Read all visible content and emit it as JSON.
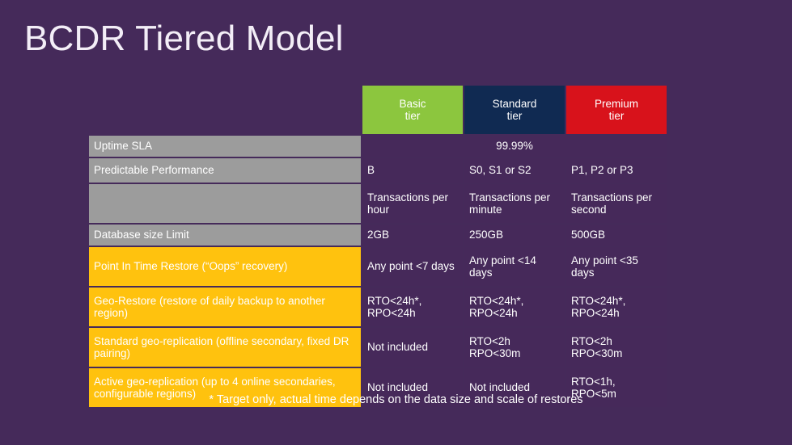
{
  "slide": {
    "title": "BCDR Tiered Model",
    "background_color": "#452A5A",
    "footnote": "* Target only, actual time depends on the data size and scale of restores"
  },
  "table": {
    "columns": [
      {
        "key": "label",
        "label": "",
        "header_color": "transparent"
      },
      {
        "key": "basic",
        "label": "Basic",
        "sub": "tier",
        "header_color": "#8CC63E"
      },
      {
        "key": "standard",
        "label": "Standard",
        "sub": "tier",
        "header_color": "#102A52"
      },
      {
        "key": "premium",
        "label": "Premium",
        "sub": "tier",
        "header_color": "#D8121B"
      }
    ],
    "rows": [
      {
        "label": "Uptime SLA",
        "label_style": "gray",
        "span_all": true,
        "span_value": "99.99%"
      },
      {
        "label": "Predictable Performance",
        "label_style": "gray",
        "basic": "B",
        "standard": "S0, S1 or S2",
        "premium": "P1, P2 or P3"
      },
      {
        "label": "",
        "label_style": "gray",
        "basic": "Transactions per hour",
        "standard": "Transactions per minute",
        "premium": "Transactions per second"
      },
      {
        "label": "Database size Limit",
        "label_style": "gray",
        "basic": "2GB",
        "standard": "250GB",
        "premium": "500GB"
      },
      {
        "label": "Point In Time Restore (“Oops” recovery)",
        "label_style": "gold",
        "basic": "Any point <7 days",
        "standard": "Any point <14 days",
        "premium": "Any point <35 days"
      },
      {
        "label": "Geo-Restore (restore of daily backup to another region)",
        "label_style": "gold",
        "basic": "RTO<24h*, RPO<24h",
        "standard": "RTO<24h*, RPO<24h",
        "premium": "RTO<24h*, RPO<24h"
      },
      {
        "label": "Standard geo-replication (offline secondary, fixed DR pairing)",
        "label_style": "gold",
        "basic": "Not included",
        "standard": "RTO<2h RPO<30m",
        "premium": "RTO<2h RPO<30m"
      },
      {
        "label": "Active geo-replication (up to 4 online secondaries, configurable regions)",
        "label_style": "gold",
        "basic": "Not included",
        "standard": "Not included",
        "premium": "RTO<1h, RPO<5m"
      }
    ]
  }
}
